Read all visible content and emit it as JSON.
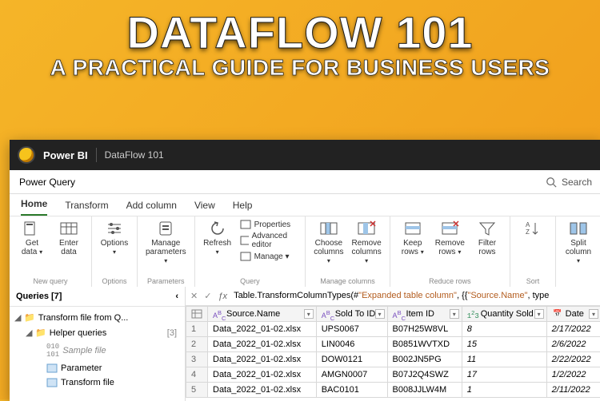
{
  "title": {
    "main": "DATAFLOW 101",
    "sub": "A PRACTICAL GUIDE FOR BUSINESS USERS"
  },
  "app": {
    "brand": "Power BI",
    "file": "DataFlow 101",
    "editor": "Power Query",
    "search": "Search"
  },
  "tabs": [
    "Home",
    "Transform",
    "Add column",
    "View",
    "Help"
  ],
  "ribbon": {
    "groups": [
      {
        "label": "New query",
        "buttons": [
          {
            "label": "Get data",
            "chev": true
          },
          {
            "label": "Enter data"
          }
        ]
      },
      {
        "label": "Options",
        "buttons": [
          {
            "label": "Options",
            "chev": true
          }
        ]
      },
      {
        "label": "Parameters",
        "buttons": [
          {
            "label": "Manage parameters",
            "chev": true
          }
        ]
      },
      {
        "label": "Query",
        "buttons": [
          {
            "label": "Refresh",
            "chev": true
          }
        ],
        "inlines": [
          "Properties",
          "Advanced editor",
          "Manage"
        ]
      },
      {
        "label": "Manage columns",
        "buttons": [
          {
            "label": "Choose columns",
            "chev": true
          },
          {
            "label": "Remove columns",
            "chev": true
          }
        ]
      },
      {
        "label": "Reduce rows",
        "buttons": [
          {
            "label": "Keep rows",
            "chev": true
          },
          {
            "label": "Remove rows",
            "chev": true
          },
          {
            "label": "Filter rows"
          }
        ]
      },
      {
        "label": "Sort",
        "buttons": [
          {
            "label": "",
            "sorticon": true
          }
        ]
      },
      {
        "label": "",
        "buttons": [
          {
            "label": "Split column",
            "chev": true
          }
        ]
      }
    ]
  },
  "queries": {
    "title": "Queries [7]",
    "tree": [
      {
        "type": "folder",
        "label": "Transform file from Q...",
        "open": true,
        "indent": 0
      },
      {
        "type": "folder",
        "label": "Helper queries",
        "count": "[3]",
        "open": true,
        "indent": 1
      },
      {
        "type": "bin",
        "label": "Sample file",
        "sample": true,
        "indent": 2
      },
      {
        "type": "param",
        "label": "Parameter",
        "indent": 2
      },
      {
        "type": "fx",
        "label": "Transform file",
        "indent": 2
      }
    ]
  },
  "formula": {
    "prefix": "Table.TransformColumnTypes(#",
    "q1": "\"Expanded table column\"",
    "mid": ", {{",
    "q2": "\"Source.Name\"",
    "suffix": ", type"
  },
  "grid": {
    "columns": [
      {
        "name": "Source.Name",
        "type": "text"
      },
      {
        "name": "Sold To ID",
        "type": "text"
      },
      {
        "name": "Item ID",
        "type": "text"
      },
      {
        "name": "Quantity Sold",
        "type": "num"
      },
      {
        "name": "Date",
        "type": "date"
      }
    ],
    "rows": [
      [
        "Data_2022_01-02.xlsx",
        "UPS0067",
        "B07H25W8VL",
        "8",
        "2/17/2022"
      ],
      [
        "Data_2022_01-02.xlsx",
        "LIN0046",
        "B0851WVTXD",
        "15",
        "2/6/2022"
      ],
      [
        "Data_2022_01-02.xlsx",
        "DOW0121",
        "B002JN5PG",
        "11",
        "2/22/2022"
      ],
      [
        "Data_2022_01-02.xlsx",
        "AMGN0007",
        "B07J2Q4SWZ",
        "17",
        "1/2/2022"
      ],
      [
        "Data_2022_01-02.xlsx",
        "BAC0101",
        "B008JJLW4M",
        "1",
        "2/11/2022"
      ]
    ]
  },
  "chart_data": {
    "type": "table",
    "columns": [
      "Source.Name",
      "Sold To ID",
      "Item ID",
      "Quantity Sold",
      "Date"
    ],
    "rows": [
      [
        "Data_2022_01-02.xlsx",
        "UPS0067",
        "B07H25W8VL",
        8,
        "2/17/2022"
      ],
      [
        "Data_2022_01-02.xlsx",
        "LIN0046",
        "B0851WVTXD",
        15,
        "2/6/2022"
      ],
      [
        "Data_2022_01-02.xlsx",
        "DOW0121",
        "B002JN5PG",
        11,
        "2/22/2022"
      ],
      [
        "Data_2022_01-02.xlsx",
        "AMGN0007",
        "B07J2Q4SWZ",
        17,
        "1/2/2022"
      ],
      [
        "Data_2022_01-02.xlsx",
        "BAC0101",
        "B008JJLW4M",
        1,
        "2/11/2022"
      ]
    ]
  }
}
